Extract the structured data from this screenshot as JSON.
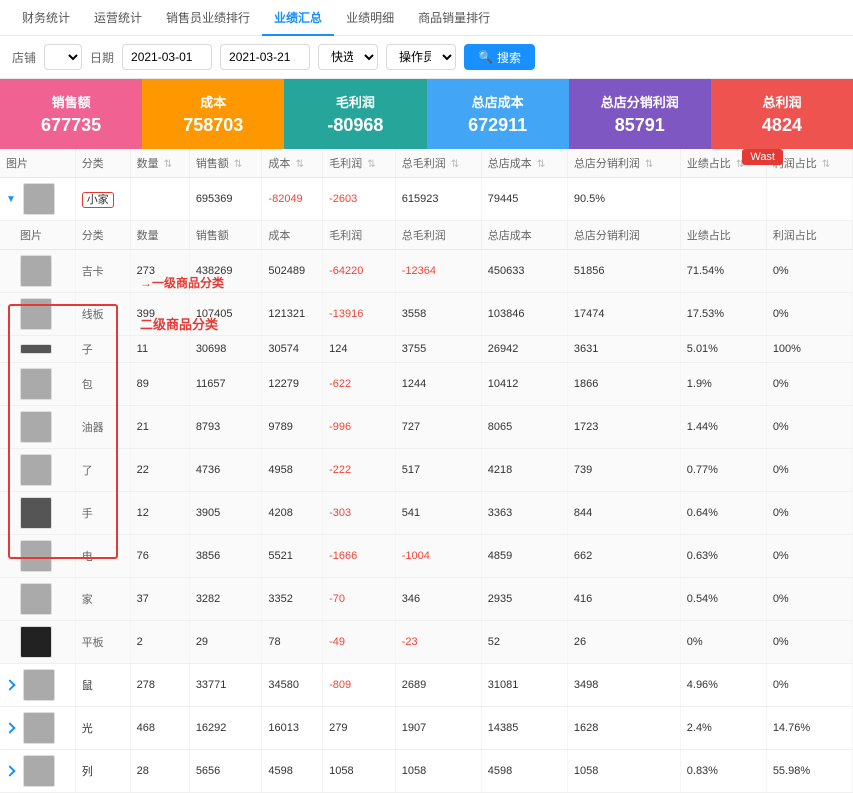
{
  "nav": {
    "items": [
      {
        "label": "财务统计",
        "active": false
      },
      {
        "label": "运营统计",
        "active": false
      },
      {
        "label": "销售员业绩排行",
        "active": false
      },
      {
        "label": "业绩汇总",
        "active": true
      },
      {
        "label": "业绩明细",
        "active": false
      },
      {
        "label": "商品销量排行",
        "active": false
      }
    ]
  },
  "filter": {
    "store_label": "店铺",
    "date_label": "日期",
    "date_start": "2021-03-01",
    "date_end": "2021-03-21",
    "quick_label": "快选",
    "operator_label": "操作员",
    "search_label": "搜索"
  },
  "kpi": {
    "cards": [
      {
        "label": "销售额",
        "value": "677735",
        "class": "pink"
      },
      {
        "label": "成本",
        "value": "758703",
        "class": "orange"
      },
      {
        "label": "毛利润",
        "value": "-80968",
        "class": "teal"
      },
      {
        "label": "总店成本",
        "value": "672911",
        "class": "blue"
      },
      {
        "label": "总店分销利润",
        "value": "85791",
        "class": "purple"
      },
      {
        "label": "总利润",
        "value": "4824",
        "class": "red"
      }
    ]
  },
  "table": {
    "headers": [
      {
        "label": "图片",
        "sortable": false
      },
      {
        "label": "分类",
        "sortable": false
      },
      {
        "label": "数量",
        "sortable": true
      },
      {
        "label": "销售额",
        "sortable": true
      },
      {
        "label": "成本",
        "sortable": true
      },
      {
        "label": "毛利润",
        "sortable": true
      },
      {
        "label": "总毛利润",
        "sortable": true
      },
      {
        "label": "总店成本",
        "sortable": true
      },
      {
        "label": "总店分销利润",
        "sortable": true
      },
      {
        "label": "业绩占比",
        "sortable": true
      },
      {
        "label": "利润占比",
        "sortable": true
      }
    ],
    "level1_row": {
      "img_class": "gray",
      "category": "小家",
      "qty": "",
      "sales": "695369",
      "cost": "-82049",
      "profit": "-2603",
      "total_profit": "615923",
      "total_cost": "79445",
      "dist_profit": "90.5%",
      "perf_ratio": "",
      "profit_ratio": ""
    },
    "sub_headers": [
      "图片",
      "分类",
      "数量",
      "销售额",
      "成本",
      "毛利润",
      "总毛利润",
      "总店成本",
      "总店分销利润",
      "业绩占比",
      "利润占比"
    ],
    "level2_rows": [
      {
        "img_class": "gray",
        "category": "吉卡",
        "qty": "273",
        "sales": "438269",
        "cost": "502489",
        "profit": "-64220",
        "total_profit": "-12364",
        "total_cost": "450633",
        "dist_profit": "51856",
        "perf_ratio": "71.54%",
        "profit_ratio": "0%"
      },
      {
        "img_class": "gray",
        "category": "线板",
        "qty": "399",
        "sales": "107405",
        "cost": "121321",
        "profit": "-13916",
        "total_profit": "3558",
        "total_cost": "103846",
        "dist_profit": "17474",
        "perf_ratio": "17.53%",
        "profit_ratio": "0%"
      },
      {
        "img_class": "dark",
        "category": "子",
        "qty": "11",
        "sales": "30698",
        "cost": "30574",
        "profit": "124",
        "total_profit": "3755",
        "total_cost": "26942",
        "dist_profit": "3631",
        "perf_ratio": "5.01%",
        "profit_ratio": "100%"
      },
      {
        "img_class": "gray",
        "category": "包",
        "qty": "89",
        "sales": "11657",
        "cost": "12279",
        "profit": "-622",
        "total_profit": "1244",
        "total_cost": "10412",
        "dist_profit": "1866",
        "perf_ratio": "1.9%",
        "profit_ratio": "0%"
      },
      {
        "img_class": "gray",
        "category": "油器",
        "qty": "21",
        "sales": "8793",
        "cost": "9789",
        "profit": "-996",
        "total_profit": "727",
        "total_cost": "8065",
        "dist_profit": "1723",
        "perf_ratio": "1.44%",
        "profit_ratio": "0%"
      },
      {
        "img_class": "gray",
        "category": "了",
        "qty": "22",
        "sales": "4736",
        "cost": "4958",
        "profit": "-222",
        "total_profit": "517",
        "total_cost": "4218",
        "dist_profit": "739",
        "perf_ratio": "0.77%",
        "profit_ratio": "0%"
      },
      {
        "img_class": "dark",
        "category": "手",
        "qty": "12",
        "sales": "3905",
        "cost": "4208",
        "profit": "-303",
        "total_profit": "541",
        "total_cost": "3363",
        "dist_profit": "844",
        "perf_ratio": "0.64%",
        "profit_ratio": "0%"
      },
      {
        "img_class": "gray",
        "category": "电",
        "qty": "76",
        "sales": "3856",
        "cost": "5521",
        "profit": "-1666",
        "total_profit": "-1004",
        "total_cost": "4859",
        "dist_profit": "662",
        "perf_ratio": "0.63%",
        "profit_ratio": "0%"
      },
      {
        "img_class": "gray",
        "category": "家",
        "qty": "37",
        "sales": "3282",
        "cost": "3352",
        "profit": "-70",
        "total_profit": "346",
        "total_cost": "2935",
        "dist_profit": "416",
        "perf_ratio": "0.54%",
        "profit_ratio": "0%"
      },
      {
        "img_class": "black",
        "category": "平板",
        "qty": "2",
        "sales": "29",
        "cost": "78",
        "profit": "-49",
        "total_profit": "-23",
        "total_cost": "52",
        "dist_profit": "26",
        "perf_ratio": "0%",
        "profit_ratio": "0%"
      }
    ],
    "other_rows": [
      {
        "expanded": false,
        "img_class": "gray",
        "category": "鼠",
        "qty": "278",
        "sales": "33771",
        "cost": "34580",
        "profit": "-809",
        "total_profit": "2689",
        "total_cost": "31081",
        "dist_profit": "3498",
        "perf_ratio": "4.96%",
        "profit_ratio": "0%"
      },
      {
        "expanded": false,
        "img_class": "gray",
        "category": "光",
        "qty": "468",
        "sales": "16292",
        "cost": "16013",
        "profit": "279",
        "total_profit": "1907",
        "total_cost": "14385",
        "dist_profit": "1628",
        "perf_ratio": "2.4%",
        "profit_ratio": "14.76%"
      },
      {
        "expanded": false,
        "img_class": "gray",
        "category": "列",
        "qty": "28",
        "sales": "5656",
        "cost": "4598",
        "profit": "1058",
        "total_profit": "1058",
        "total_cost": "4598",
        "dist_profit": "1058",
        "perf_ratio": "0.83%",
        "profit_ratio": "55.98%"
      }
    ]
  },
  "annotations": {
    "level1_label": "一级商品分类",
    "level2_label": "二级商品分类",
    "wast_label": "Wast"
  }
}
